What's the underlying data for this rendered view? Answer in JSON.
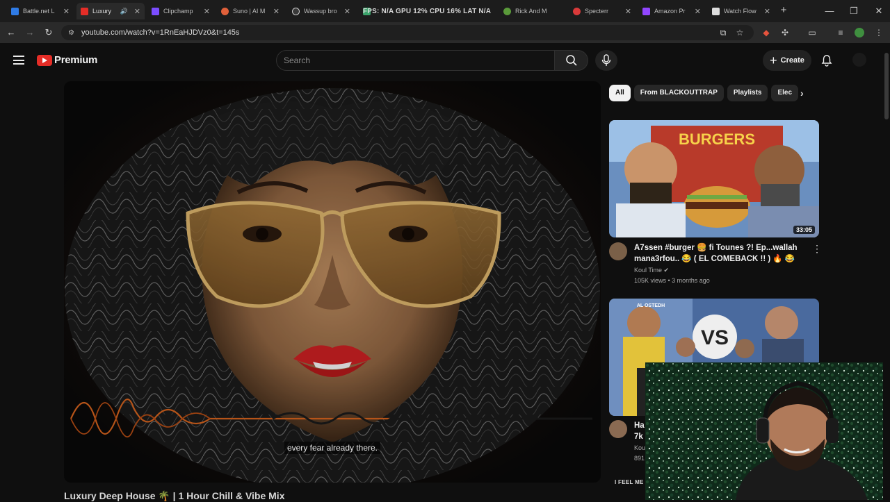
{
  "browser": {
    "tabs": [
      {
        "title": "Battle.net L",
        "icon": "battlenet-icon",
        "color": "#2f7be6"
      },
      {
        "title": "Luxury",
        "icon": "youtube-icon",
        "color": "#e52d27",
        "active": true
      },
      {
        "title": "Clipchamp",
        "icon": "clipchamp-icon",
        "color": "#7b4dff"
      },
      {
        "title": "Suno | AI M",
        "icon": "suno-icon",
        "color": "#e0603a"
      },
      {
        "title": "Wassup bro",
        "icon": "chatgpt-icon",
        "color": "#cfcfcf"
      },
      {
        "title": "",
        "icon": "tab-icon",
        "color": "#3aa36a"
      },
      {
        "title": "Rick And M",
        "icon": "rick-icon",
        "color": "#5a9a3a"
      },
      {
        "title": "Specterr",
        "icon": "specterr-icon",
        "color": "#d93a3a"
      },
      {
        "title": "Amazon Pr",
        "icon": "twitch-icon",
        "color": "#9146ff"
      },
      {
        "title": "Watch Flow",
        "icon": "watch-icon",
        "color": "#dddddd"
      }
    ],
    "perf_overlay": "FPS: N/A   GPU 12%   CPU 16%   LAT N/A",
    "url": "youtube.com/watch?v=1RnEaHJDVz0&t=145s",
    "new_tab": "+",
    "minimize": "—",
    "restore": "❐",
    "close": "✕"
  },
  "youtube": {
    "logo_text": "Premium",
    "search_placeholder": "Search",
    "create_label": "Create",
    "caption": "every fear already there.",
    "video_title": "Luxury Deep House 🌴 | 1 Hour Chill & Vibe Mix",
    "chips": [
      "All",
      "From BLACKOUTTRAP",
      "Playlists",
      "Elec"
    ],
    "recommendations": [
      {
        "title": "A7ssen #burger 🍔 fi Tounes ?! Ep...wallah mana3rfou.. 😂 ( EL COMEBACK !! ) 🔥 😂",
        "channel": "Koul Time ✔",
        "meta": "105K views • 3 months ago",
        "duration": "33:05",
        "thumb_text": "BURGERS"
      },
      {
        "title": "Ha",
        "title2": "7k",
        "channel": "Kou",
        "meta": "891",
        "thumb_text": "VS",
        "thumb_label": "AL OSTEDH"
      }
    ],
    "next_label": "I FEEL ME"
  },
  "colors": {
    "accent_red": "#e52d27",
    "background": "#0f0f0f",
    "chip_bg": "#272727"
  }
}
